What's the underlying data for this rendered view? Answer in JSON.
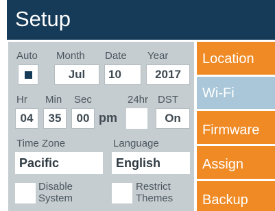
{
  "header": {
    "title": "Setup"
  },
  "date": {
    "auto_label": "Auto",
    "month_label": "Month",
    "date_label": "Date",
    "year_label": "Year",
    "month_value": "Jul",
    "date_value": "10",
    "year_value": "2017",
    "auto_checked": true
  },
  "time": {
    "hr_label": "Hr",
    "min_label": "Min",
    "sec_label": "Sec",
    "h24_label": "24hr",
    "dst_label": "DST",
    "hr_value": "04",
    "min_value": "35",
    "sec_value": "00",
    "ampm": "pm",
    "dst_value": "On"
  },
  "settings": {
    "timezone_label": "Time Zone",
    "timezone_value": "Pacific",
    "language_label": "Language",
    "language_value": "English",
    "disable_label_1": "Disable",
    "disable_label_2": "System",
    "restrict_label_1": "Restrict",
    "restrict_label_2": "Themes"
  },
  "nav": {
    "location": "Location",
    "wifi": "Wi-Fi",
    "firmware": "Firmware",
    "assign": "Assign",
    "backup": "Backup"
  },
  "colors": {
    "header": "#163b58",
    "panel": "#c5cdd0",
    "orange": "#f08a24",
    "selected": "#a9c7d9"
  }
}
